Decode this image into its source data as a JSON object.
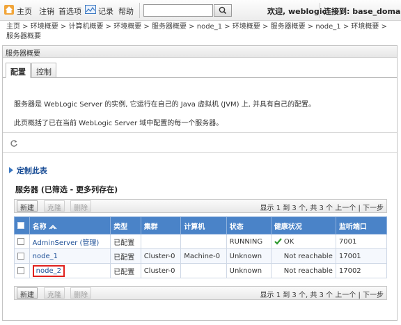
{
  "topbar": {
    "home": "主页",
    "logout": "注销",
    "prefs": "首选项",
    "record": "记录",
    "help": "帮助",
    "search_value": "",
    "welcome": "欢迎, weblogic",
    "connected": "连接到: base_domain"
  },
  "breadcrumbs": [
    "主页 >",
    "环境概要 >",
    "计算机概要 >",
    "环境概要 >",
    "服务器概要 >",
    "node_1 >",
    "环境概要 >",
    "服务器概要 >",
    "node_1 >",
    "环境概要 >",
    "服务器概要"
  ],
  "panel": {
    "title": "服务器概要",
    "tabs": [
      "配置",
      "控制"
    ],
    "description1": "服务器是 WebLogic Server 的实例, 它运行在自己的 Java 虚拟机 (JVM) 上, 并具有自己的配置。",
    "description2": "此页概括了已在当前 WebLogic Server 域中配置的每一个服务器。",
    "customize": "定制此表",
    "table_title": "服务器 (已筛选 - 更多列存在)"
  },
  "toolbar": {
    "new": "新建",
    "clone": "克隆",
    "delete": "删除",
    "showing": "显示 1 到 3 个, 共 3 个",
    "prev": "上一个",
    "divider": "|",
    "next": "下一步"
  },
  "table": {
    "headers": {
      "name": "名称",
      "type": "类型",
      "cluster": "集群",
      "machine": "计算机",
      "state": "状态",
      "health": "健康状况",
      "port": "监听端口"
    },
    "rows": [
      {
        "name": "AdminServer (管理)",
        "type": "已配置",
        "cluster": "",
        "machine": "",
        "state": "RUNNING",
        "health": "OK",
        "port": "7001"
      },
      {
        "name": "node_1",
        "type": "已配置",
        "cluster": "Cluster-0",
        "machine": "Machine-0",
        "state": "Unknown",
        "health": "Not reachable",
        "port": "17001"
      },
      {
        "name": "node_2",
        "type": "已配置",
        "cluster": "Cluster-0",
        "machine": "",
        "state": "Unknown",
        "health": "Not reachable",
        "port": "17002"
      }
    ]
  },
  "colors": {
    "header_blue": "#4a83c8",
    "link_blue": "#1b4e96",
    "highlight_red": "#e0201c",
    "ok_green": "#2e9a2e"
  }
}
